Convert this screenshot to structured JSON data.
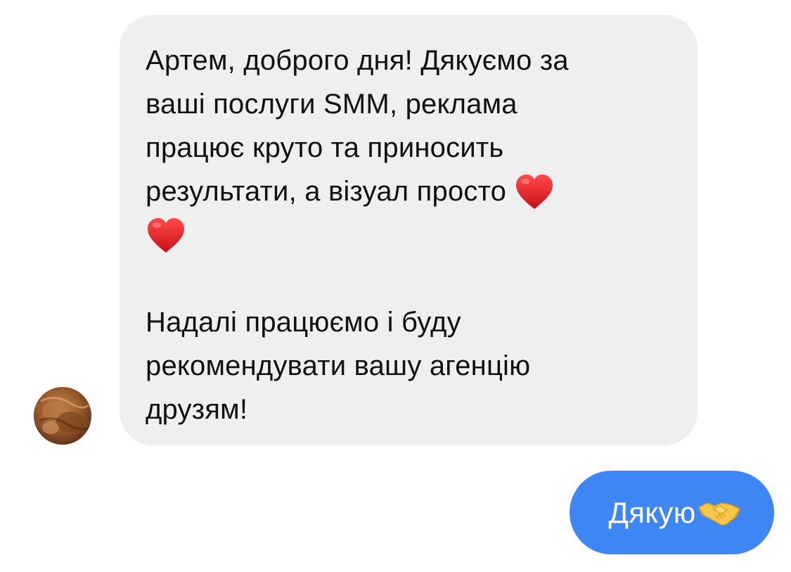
{
  "conversation": {
    "incoming": {
      "avatar_icon": "contact-avatar-icon",
      "lines": [
        "Артем, доброго дня! Дякуємо за",
        "ваші послуги SMM, реклама",
        "працює круто та приносить",
        "результати, а візуал просто"
      ],
      "lines_after_gap": [
        "Надалі працюємо і буду",
        "рекомендувати вашу агенцію",
        "друзям!"
      ],
      "emoji": [
        "red-heart-icon",
        "red-heart-icon"
      ],
      "bubble_color": "#efefef",
      "text_color": "#111111"
    },
    "outgoing": {
      "text": "Дякую",
      "emoji": "handshake-icon",
      "bubble_color": "#3d86f4",
      "text_color": "#ffffff"
    }
  }
}
